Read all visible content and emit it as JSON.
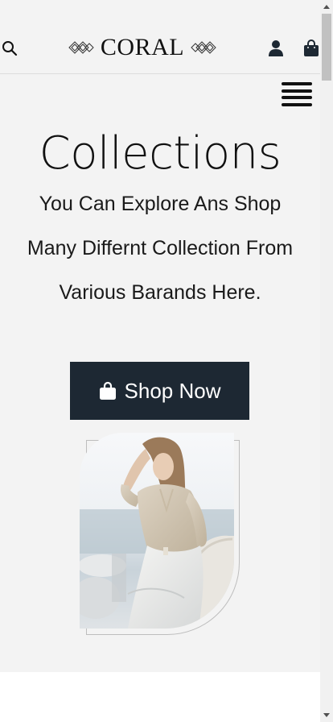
{
  "header": {
    "brand": "CORAL",
    "icons": {
      "search": "search-icon",
      "account": "user-icon",
      "cart": "shopping-bag-icon",
      "menu": "hamburger-menu-icon",
      "logo_ornament": "diamond-ornament-icon"
    }
  },
  "hero": {
    "title": "Collections",
    "subtitle": "You Can Explore Ans Shop Many Differnt Collection From Various Barands Here.",
    "cta_label": "Shop Now",
    "cta_icon": "shopping-bag-icon",
    "image_alt": "woman in beige blouse and white trousers"
  },
  "colors": {
    "background": "#f3f3f3",
    "button": "#1d2833",
    "button_text": "#ffffff",
    "text": "#111111"
  }
}
